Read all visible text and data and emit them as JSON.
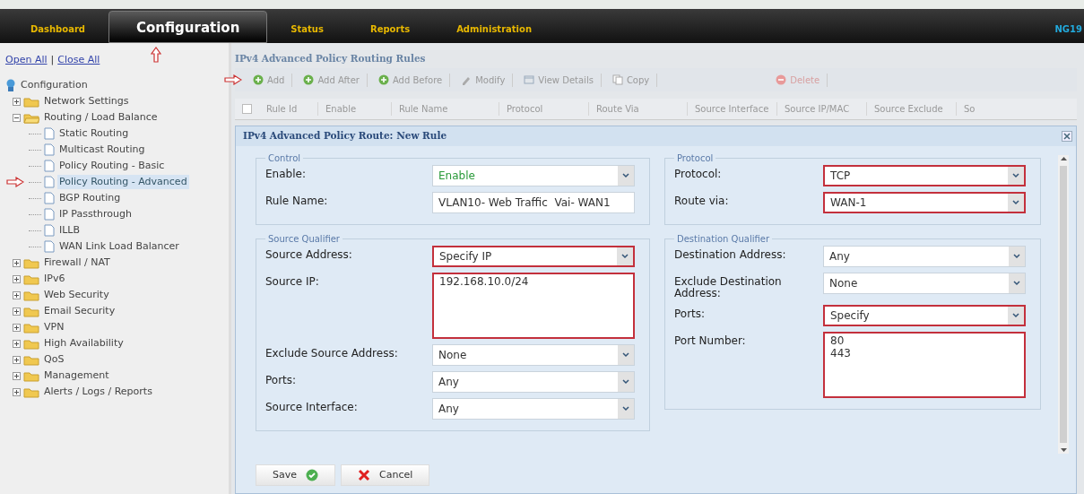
{
  "nav": {
    "tabs": [
      {
        "label": "Dashboard",
        "selected": false,
        "pointer": false
      },
      {
        "label": "Configuration",
        "selected": true,
        "pointer": true
      },
      {
        "label": "Status",
        "selected": false,
        "pointer": false
      },
      {
        "label": "Reports",
        "selected": false,
        "pointer": false
      },
      {
        "label": "Administration",
        "selected": false,
        "pointer": false
      }
    ],
    "right_text": "NG19"
  },
  "sidebar": {
    "links": [
      "Open All",
      "Close All"
    ],
    "link_separator": "|",
    "tree": {
      "label": "Configuration",
      "children": [
        {
          "label": "Network Settings",
          "expanded": false
        },
        {
          "label": "Routing / Load Balance",
          "expanded": true,
          "children": [
            {
              "label": "Static Routing",
              "selected": false,
              "pointer": false
            },
            {
              "label": "Multicast Routing",
              "selected": false,
              "pointer": false
            },
            {
              "label": "Policy Routing - Basic",
              "selected": false,
              "pointer": false
            },
            {
              "label": "Policy Routing - Advanced",
              "selected": true,
              "pointer": true
            },
            {
              "label": "BGP Routing",
              "selected": false,
              "pointer": false
            },
            {
              "label": "IP Passthrough",
              "selected": false,
              "pointer": false
            },
            {
              "label": "ILLB",
              "selected": false,
              "pointer": false
            },
            {
              "label": "WAN Link Load Balancer",
              "selected": false,
              "pointer": false
            }
          ]
        },
        {
          "label": "Firewall / NAT",
          "expanded": false
        },
        {
          "label": "IPv6",
          "expanded": false
        },
        {
          "label": "Web Security",
          "expanded": false
        },
        {
          "label": "Email Security",
          "expanded": false
        },
        {
          "label": "VPN",
          "expanded": false
        },
        {
          "label": "High Availability",
          "expanded": false
        },
        {
          "label": "QoS",
          "expanded": false
        },
        {
          "label": "Management",
          "expanded": false
        },
        {
          "label": "Alerts / Logs / Reports",
          "expanded": false
        }
      ]
    }
  },
  "panel": {
    "title": "IPv4 Advanced Policy Routing Rules",
    "toolbar": [
      {
        "label": "Add",
        "kind": "add",
        "disabled": false,
        "pointer": true
      },
      {
        "label": "Add After",
        "kind": "add",
        "disabled": false,
        "pointer": false
      },
      {
        "label": "Add Before",
        "kind": "add",
        "disabled": false,
        "pointer": false
      },
      {
        "label": "Modify",
        "kind": "edit",
        "disabled": false,
        "pointer": false
      },
      {
        "label": "View Details",
        "kind": "view",
        "disabled": false,
        "pointer": false
      },
      {
        "label": "Copy",
        "kind": "copy",
        "disabled": false,
        "pointer": false
      },
      {
        "label": "Delete",
        "kind": "delete",
        "disabled": true,
        "pointer": false
      }
    ],
    "header_checkbox": {
      "checked": false
    },
    "columns": [
      "Rule Id",
      "Enable",
      "Rule Name",
      "Protocol",
      "Route Via",
      "Source Interface",
      "Source IP/MAC",
      "Source Exclude",
      "So"
    ]
  },
  "dialog": {
    "title": "IPv4 Advanced Policy Route: New Rule",
    "columns": [
      [
        {
          "title": "Control",
          "fields": [
            {
              "label": "Enable:",
              "kind": "select",
              "value": "Enable",
              "highlighted": false,
              "positive": true
            },
            {
              "label": "Rule Name:",
              "kind": "text",
              "value": "VLAN10- Web Traffic  Vai- WAN1",
              "highlighted": false,
              "positive": false
            }
          ]
        },
        {
          "title": "Source Qualifier",
          "fields": [
            {
              "label": "Source Address:",
              "kind": "select",
              "value": "Specify IP",
              "highlighted": true,
              "positive": false
            },
            {
              "label": "Source IP:",
              "kind": "textarea",
              "value": "192.168.10.0/24",
              "highlighted": true,
              "positive": false
            },
            {
              "label": "Exclude Source Address:",
              "kind": "select",
              "value": "None",
              "highlighted": false,
              "positive": false
            },
            {
              "label": "Ports:",
              "kind": "select",
              "value": "Any",
              "highlighted": false,
              "positive": false
            },
            {
              "label": "Source Interface:",
              "kind": "select",
              "value": "Any",
              "highlighted": false,
              "positive": false
            }
          ]
        }
      ],
      [
        {
          "title": "Protocol",
          "fields": [
            {
              "label": "Protocol:",
              "kind": "select",
              "value": "TCP",
              "highlighted": true,
              "positive": false
            },
            {
              "label": "Route via:",
              "kind": "select",
              "value": "WAN-1",
              "highlighted": true,
              "positive": false
            }
          ]
        },
        {
          "title": "Destination Qualifier",
          "fields": [
            {
              "label": "Destination Address:",
              "kind": "select",
              "value": "Any",
              "highlighted": false,
              "positive": false
            },
            {
              "label": "Exclude Destination Address:",
              "kind": "select",
              "value": "None",
              "highlighted": false,
              "positive": false
            },
            {
              "label": "Ports:",
              "kind": "select",
              "value": "Specify",
              "highlighted": true,
              "positive": false
            },
            {
              "label": "Port Number:",
              "kind": "textarea",
              "value": "80\n443",
              "highlighted": true,
              "positive": false
            }
          ]
        }
      ]
    ],
    "buttons": [
      {
        "label": "Save",
        "kind": "save"
      },
      {
        "label": "Cancel",
        "kind": "cancel"
      }
    ]
  }
}
